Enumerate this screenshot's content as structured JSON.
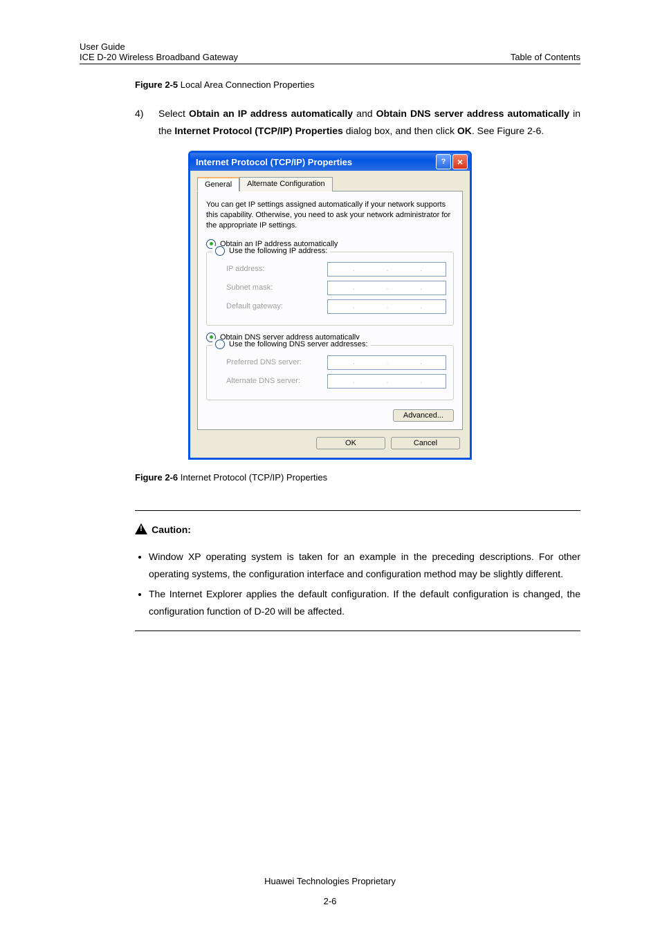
{
  "header": {
    "line1": "User Guide",
    "line2": "ICE D-20 Wireless Broadband Gateway",
    "right": "Table of Contents"
  },
  "fig25": {
    "label": "Figure 2-5",
    "text": " Local Area Connection Properties"
  },
  "step": {
    "num": "4)",
    "t1": "Select ",
    "b1": "Obtain an IP address automatically",
    "t2": " and ",
    "b2": "Obtain DNS server address automatically",
    "t3": " in the ",
    "b3": "Internet Protocol (TCP/IP) Properties",
    "t4": " dialog box, and then click ",
    "b4": "OK",
    "t5": ". See Figure 2-6."
  },
  "dialog": {
    "title": "Internet Protocol (TCP/IP) Properties",
    "tabs": {
      "general": "General",
      "alt": "Alternate Configuration"
    },
    "desc": "You can get IP settings assigned automatically if your network supports this capability. Otherwise, you need to ask your network administrator for the appropriate IP settings.",
    "r_auto_ip": "Obtain an IP address automatically",
    "r_use_ip": "Use the following IP address:",
    "ip_address": "IP address:",
    "subnet": "Subnet mask:",
    "gateway": "Default gateway:",
    "r_auto_dns": "Obtain DNS server address automatically",
    "r_use_dns": "Use the following DNS server addresses:",
    "pref_dns": "Preferred DNS server:",
    "alt_dns": "Alternate DNS server:",
    "advanced": "Advanced...",
    "ok": "OK",
    "cancel": "Cancel"
  },
  "fig26": {
    "label": "Figure 2-6",
    "text": " Internet Protocol (TCP/IP) Properties"
  },
  "caution": {
    "label": "Caution:",
    "b1": "Window XP operating system is taken for an example in the preceding descriptions. For other operating systems, the configuration interface and configuration method may be slightly different.",
    "b2": "The Internet Explorer applies the default configuration. If the default configuration is changed, the configuration function of D-20 will be affected."
  },
  "footer": {
    "line1": "Huawei Technologies Proprietary",
    "pagenum": "2-6"
  }
}
